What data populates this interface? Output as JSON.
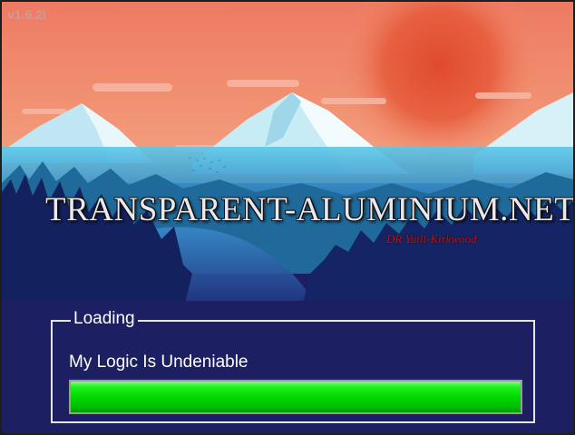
{
  "app": {
    "version": "v1.6.2i",
    "site_title": "TRANSPARENT-ALUMINIUM.NET",
    "author": "DR Yuill-Kirkwood"
  },
  "loading": {
    "group_label": "Loading",
    "status_text": "My Logic Is Undeniable",
    "progress_fraction": 1.0,
    "bar_color": "#00d800"
  },
  "colors": {
    "sky": "#f08a6c",
    "sun": "#e2583a",
    "background_navy": "#1c2062"
  }
}
